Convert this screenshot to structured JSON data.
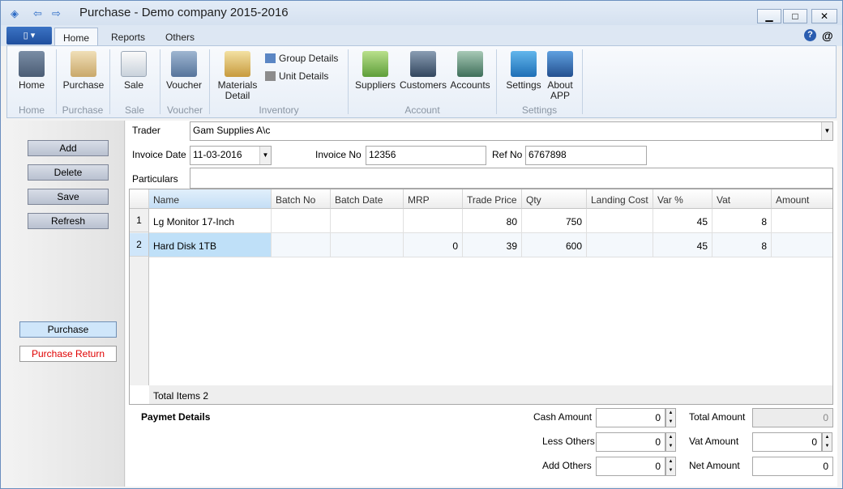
{
  "window": {
    "title": "Purchase - Demo company 2015-2016",
    "minimize": "▁",
    "maximize": "□",
    "close": "✕"
  },
  "tabs": [
    "Home",
    "Reports",
    "Others"
  ],
  "ribbon": {
    "home": "Home",
    "purchase": "Purchase",
    "sale": "Sale",
    "voucher": "Voucher",
    "materials": "Materials",
    "materials2": "Detail",
    "group_details": "Group Details",
    "unit_details": "Unit Details",
    "suppliers": "Suppliers",
    "customers": "Customers",
    "accounts": "Accounts",
    "settings": "Settings",
    "about": "About",
    "about2": "APP",
    "groups": {
      "home": "Home",
      "purchase": "Purchase",
      "sale": "Sale",
      "voucher": "Voucher",
      "inventory": "Inventory",
      "account": "Account",
      "settings": "Settings"
    }
  },
  "left": {
    "add": "Add",
    "delete": "Delete",
    "save": "Save",
    "refresh": "Refresh",
    "purchase": "Purchase",
    "purchase_return": "Purchase Return"
  },
  "form": {
    "trader_label": "Trader",
    "trader": "Gam Supplies A\\c",
    "invoice_date_label": "Invoice Date",
    "invoice_date": "11-03-2016",
    "invoice_no_label": "Invoice No",
    "invoice_no": "12356",
    "ref_no_label": "Ref No",
    "ref_no": "6767898",
    "particulars_label": "Particulars"
  },
  "grid": {
    "columns": [
      "Name",
      "Batch No",
      "Batch Date",
      "MRP",
      "Trade Price",
      "Qty",
      "Landing Cost",
      "Var %",
      "Vat",
      "Amount"
    ],
    "rows": [
      {
        "n": "1",
        "name": "Lg Monitor 17-Inch",
        "batch_no": "",
        "batch_date": "",
        "mrp": "",
        "trade_price": "80",
        "qty": "750",
        "landing": "",
        "var": "45",
        "vat": "8",
        "amount": ""
      },
      {
        "n": "2",
        "name": "Hard Disk 1TB",
        "batch_no": "",
        "batch_date": "",
        "mrp": "0",
        "trade_price": "39",
        "qty": "600",
        "landing": "",
        "var": "45",
        "vat": "8",
        "amount": ""
      }
    ],
    "total": "Total Items 2"
  },
  "payment": {
    "title": "Paymet Details",
    "cash_label": "Cash Amount",
    "cash": "0",
    "less_label": "Less Others",
    "less": "0",
    "add_label": "Add Others",
    "add": "0",
    "total_label": "Total Amount",
    "total": "0",
    "vat_label": "Vat Amount",
    "vat": "0",
    "net_label": "Net Amount",
    "net": "0"
  }
}
